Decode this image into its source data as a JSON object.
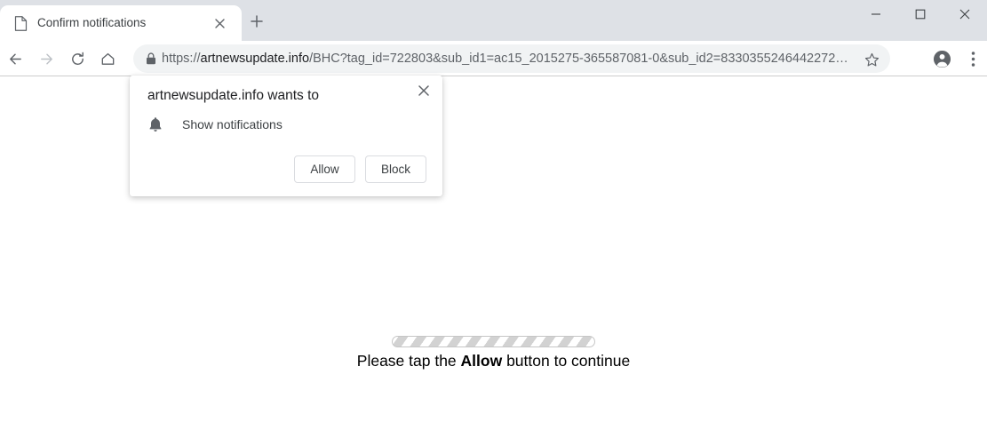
{
  "window": {
    "controls": {
      "minimize": "minimize",
      "maximize": "maximize",
      "close": "close"
    }
  },
  "tabstrip": {
    "tabs": [
      {
        "title": "Confirm notifications",
        "favicon": "page-icon",
        "close_label": "close-tab"
      }
    ],
    "new_tab_label": "new-tab"
  },
  "toolbar": {
    "back_label": "Back",
    "forward_label": "Forward",
    "reload_label": "Reload",
    "home_label": "Home",
    "bookmark_label": "Bookmark this tab",
    "profile_label": "Profile",
    "menu_label": "Customize and control Google Chrome",
    "omnibox": {
      "security_icon": "lock-icon",
      "url_scheme": "https://",
      "url_domain": "artnewsupdate.info",
      "url_path": "/BHC?tag_id=722803&sub_id1=ac15_2015275-365587081-0&sub_id2=8330355246442272…",
      "full_url": "https://artnewsupdate.info/BHC?tag_id=722803&sub_id1=ac15_2015275-365587081-0&sub_id2=8330355246442272…"
    }
  },
  "dialog": {
    "title": "artnewsupdate.info wants to",
    "permission_icon": "bell-icon",
    "permission_label": "Show notifications",
    "allow_label": "Allow",
    "block_label": "Block",
    "close_label": "close-dialog"
  },
  "page": {
    "progress_label": "loading-progress",
    "instruction_prefix": "Please tap the ",
    "instruction_emphasis": "Allow",
    "instruction_suffix": " button to continue"
  },
  "colors": {
    "tabstrip_bg": "#dee1e6",
    "toolbar_bg": "#ffffff",
    "omnibox_bg": "#f1f3f4",
    "text_primary": "#202124",
    "text_secondary": "#5f6368",
    "button_border": "#dadce0",
    "page_bg": "#ffffff"
  }
}
